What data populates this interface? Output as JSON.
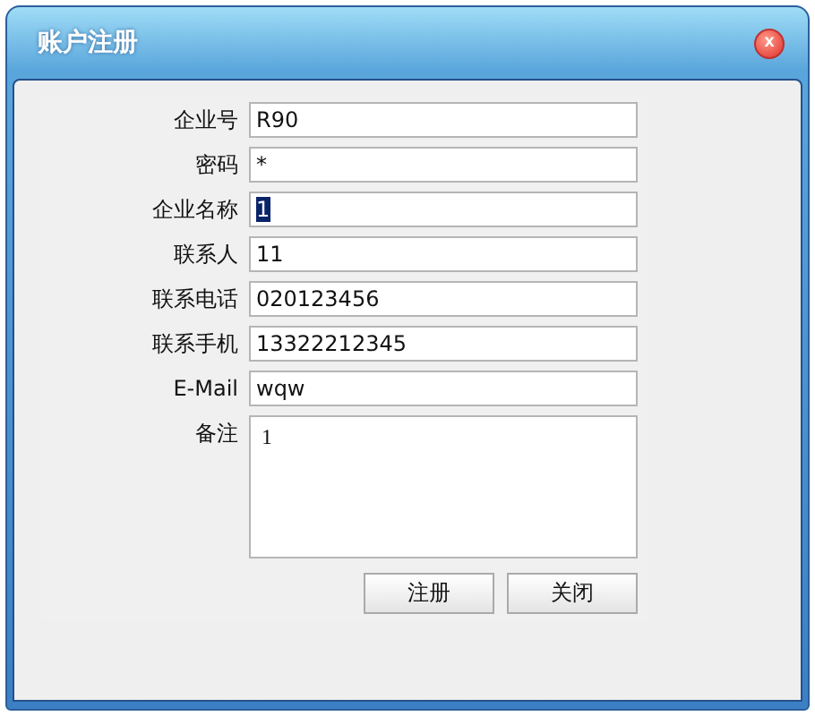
{
  "window": {
    "title": "账户注册",
    "close": "x"
  },
  "fields": [
    {
      "label": "企业号",
      "value": "R90",
      "kind": "line",
      "selected": false
    },
    {
      "label": "密码",
      "value": "*",
      "kind": "line",
      "selected": false
    },
    {
      "label": "企业名称",
      "value": "1",
      "kind": "line",
      "selected": true
    },
    {
      "label": "联系人",
      "value": "11",
      "kind": "line",
      "selected": false
    },
    {
      "label": "联系电话",
      "value": "020123456",
      "kind": "line",
      "selected": false
    },
    {
      "label": "联系手机",
      "value": "13322212345",
      "kind": "line",
      "selected": false
    },
    {
      "label": "E-Mail",
      "value": "wqw",
      "kind": "line",
      "selected": false
    },
    {
      "label": "备注",
      "value": "1",
      "kind": "area",
      "selected": false
    }
  ],
  "buttons": [
    "注册",
    "关闭"
  ]
}
